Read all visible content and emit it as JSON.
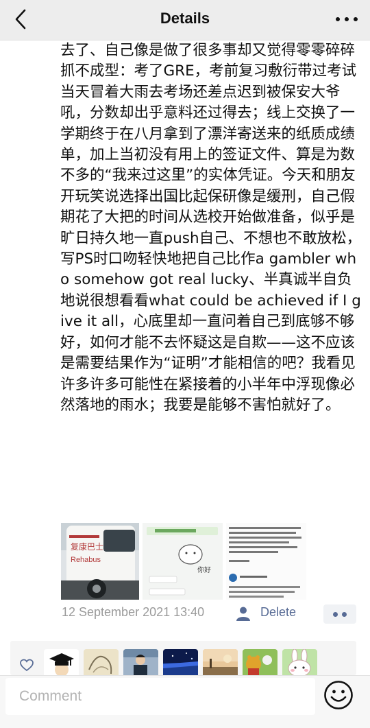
{
  "header": {
    "title": "Details",
    "back_icon": "chevron-left-icon",
    "more_icon": "ellipsis-icon"
  },
  "post": {
    "text": "去了、自己像是做了很多事却又觉得零零碎碎抓不成型：考了GRE，考前复习敷衍带过考试当天冒着大雨去考场还差点迟到被保安大爷吼，分数却出乎意料还过得去；线上交换了一学期终于在八月拿到了漂洋寄送来的纸质成绩单，加上当初没有用上的签证文件、算是为数不多的“我来过这里”的实体凭证。今天和朋友开玩笑说选择出国比起保研像是缓刑，自己假期花了大把的时间从选校开始做准备，似乎是旷日持久地一直push自己、不想也不敢放松，写PS时口吻轻快地把自己比作a gambler who somehow got real lucky、半真诚半自负地说很想看看what could be achieved if I give it all，心底里却一直问着自己到底够不够好，如何才能不去怀疑这是自欺——这不应该是需要结果作为“证明”才能相信的吧？我看见许多许多可能性在紧接着的小半年中浮现像必然落地的雨水；我要是能够不害怕就好了。",
    "images": [
      {
        "kind": "bus photo",
        "texts": [
          "复康巴士",
          "Rehabus"
        ]
      },
      {
        "kind": "chat screenshot",
        "texts": [
          "你好"
        ]
      },
      {
        "kind": "email screenshot",
        "texts": []
      }
    ],
    "timestamp": "12 September 2021 13:40",
    "delete_label": "Delete",
    "delete_icon": "person-icon",
    "more_actions_icon": "more-dots-icon"
  },
  "likes": {
    "icon": "heart-outline-icon",
    "avatars": [
      "graduate-avatar",
      "sketch-avatar",
      "person-avatar",
      "night-sky-avatar",
      "sunset-avatar",
      "pooh-avatar",
      "bunny-avatar"
    ]
  },
  "comment": {
    "placeholder": "Comment",
    "emoji_icon": "smiley-icon"
  },
  "colors": {
    "link": "#576b95",
    "nav_bg": "#ededed",
    "meta_text": "#9a9a9a"
  }
}
